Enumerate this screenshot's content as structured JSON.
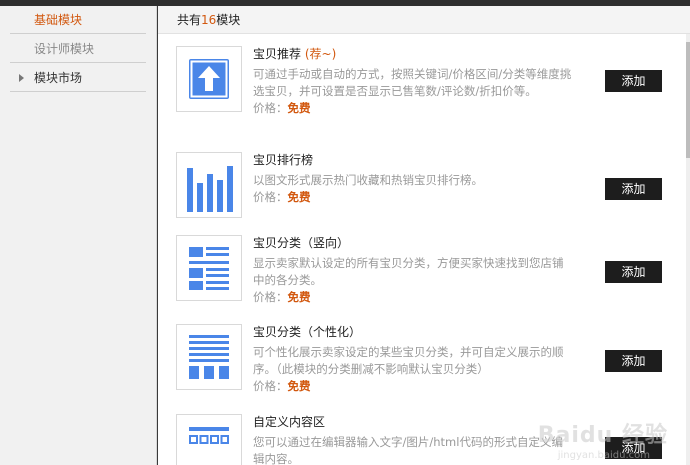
{
  "sidebar": {
    "items": [
      {
        "label": "基础模块",
        "state": "active"
      },
      {
        "label": "设计师模块",
        "state": "muted"
      },
      {
        "label": "模块市场",
        "state": "market"
      }
    ]
  },
  "header": {
    "prefix": "共有",
    "count": "16",
    "suffix": "模块"
  },
  "modules": [
    {
      "icon": "upload-arrow-icon",
      "title": "宝贝推荐",
      "tag": "(荐~)",
      "desc": "可通过手动或自动的方式，按照关键词/价格区间/分类等维度挑选宝贝，并可设置是否显示已售笔数/评论数/折扣价等。",
      "price_label": "价格：",
      "price": "免费",
      "button": "添加"
    },
    {
      "icon": "bar-chart-icon",
      "title": "宝贝排行榜",
      "tag": "",
      "desc": "以图文形式展示热门收藏和热销宝贝排行榜。",
      "price_label": "价格：",
      "price": "免费",
      "button": "添加"
    },
    {
      "icon": "category-list-icon",
      "title": "宝贝分类（竖向）",
      "tag": "",
      "desc": "显示卖家默认设定的所有宝贝分类，方便买家快速找到您店铺中的各分类。",
      "price_label": "价格：",
      "price": "免费",
      "button": "添加"
    },
    {
      "icon": "custom-category-icon",
      "title": "宝贝分类（个性化）",
      "tag": "",
      "desc": "可个性化展示卖家设定的某些宝贝分类，并可自定义展示的顺序。（此模块的分类删减不影响默认宝贝分类）",
      "price_label": "价格：",
      "price": "免费",
      "button": "添加"
    },
    {
      "icon": "custom-content-icon",
      "title": "自定义内容区",
      "tag": "",
      "desc": "您可以通过在编辑器输入文字/图片/html代码的形式自定义编辑内容。",
      "price_label": "",
      "price": "",
      "button": "添加"
    }
  ],
  "watermark": {
    "text": "Baidu 经验",
    "sub": "jingyan.baidu.com"
  },
  "colors": {
    "accent": "#d2580f",
    "icon_blue": "#4a86e8",
    "button_bg": "#1d1d1d"
  }
}
